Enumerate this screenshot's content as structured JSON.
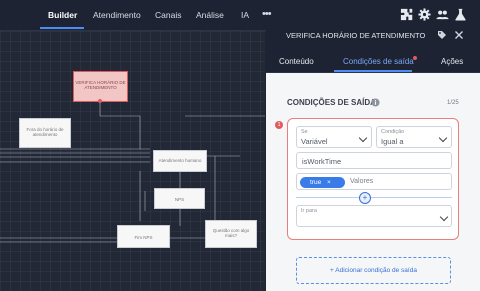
{
  "nav": {
    "items": [
      "Builder",
      "Atendimento",
      "Canais",
      "Análise",
      "IA"
    ],
    "more": "•••",
    "icons": [
      "puzzle-icon",
      "gear-icon",
      "users-icon",
      "flask-icon"
    ]
  },
  "canvas": {
    "nodes": {
      "verifica": "VERIFICA HORÁRIO DE ATENDIMENTO",
      "fora": "Fora do horário de atendimento",
      "atendimento": "Atendimento humano",
      "nps": "NPS",
      "fim": "Fim NPS",
      "questao": "Questão com algo mais?"
    }
  },
  "panel": {
    "title": "VERIFICA HORÁRIO DE ATENDIMENTO",
    "tabs": [
      "Conteúdo",
      "Condições de saída",
      "Ações"
    ],
    "section_title": "CONDIÇÕES DE SAÍDA",
    "counter": "1/25",
    "condition": {
      "index": "1",
      "se_label": "Se",
      "se_value": "Variável",
      "cond_label": "Condição",
      "cond_value": "Igual a",
      "variable_value": "isWorkTime",
      "chip_value": "true",
      "chip_remove": "×",
      "values_placeholder": "Valores",
      "add_symbol": "+",
      "ir_para_label": "Ir para"
    },
    "add_button": "+ Adicionar condição de saída"
  },
  "colors": {
    "accent": "#4d8cf5",
    "error": "#e05b5b",
    "chip": "#3a7bea",
    "header_bg": "#1d2332"
  }
}
